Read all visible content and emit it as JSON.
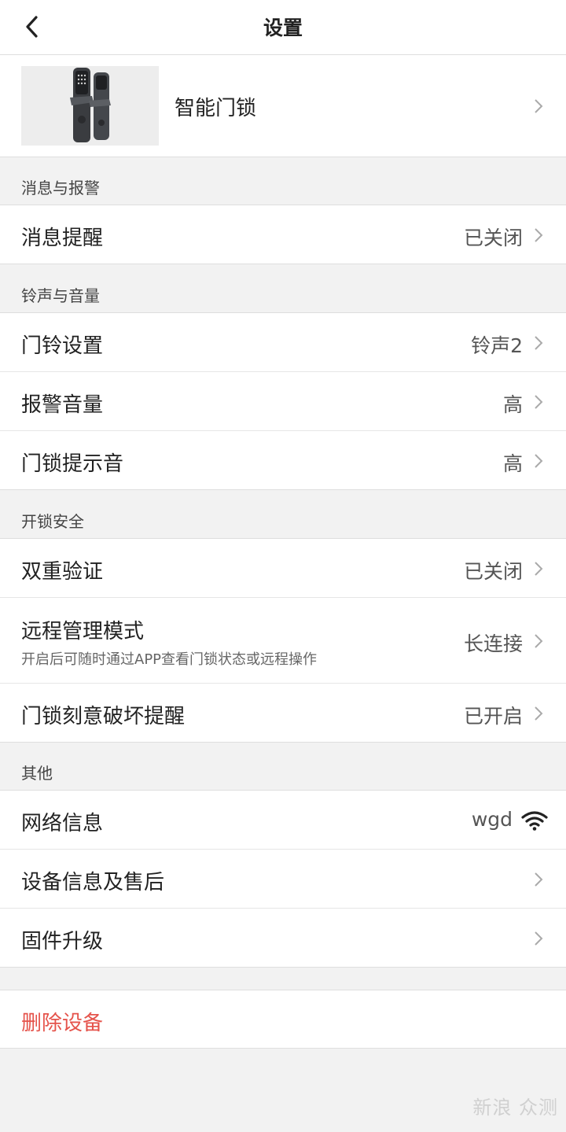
{
  "header": {
    "title": "设置"
  },
  "device": {
    "name": "智能门锁"
  },
  "sections": {
    "alerts": "消息与报警",
    "sound": "铃声与音量",
    "security": "开锁安全",
    "other": "其他"
  },
  "rows": {
    "message_reminder": {
      "label": "消息提醒",
      "value": "已关闭"
    },
    "doorbell": {
      "label": "门铃设置",
      "value": "铃声2"
    },
    "alarm_volume": {
      "label": "报警音量",
      "value": "高"
    },
    "lock_tone": {
      "label": "门锁提示音",
      "value": "高"
    },
    "two_factor": {
      "label": "双重验证",
      "value": "已关闭"
    },
    "remote_mode": {
      "label": "远程管理模式",
      "sub": "开启后可随时通过APP查看门锁状态或远程操作",
      "value": "长连接"
    },
    "tamper_alert": {
      "label": "门锁刻意破坏提醒",
      "value": "已开启"
    },
    "network": {
      "label": "网络信息",
      "value": "wgd"
    },
    "device_info": {
      "label": "设备信息及售后"
    },
    "firmware": {
      "label": "固件升级"
    }
  },
  "delete": {
    "label": "删除设备",
    "color": "#e5534b"
  },
  "watermark": "新浪 众测",
  "icons": {
    "back": "chevron-left-icon",
    "row_arrow": "chevron-right-icon",
    "network": "wifi-icon"
  }
}
